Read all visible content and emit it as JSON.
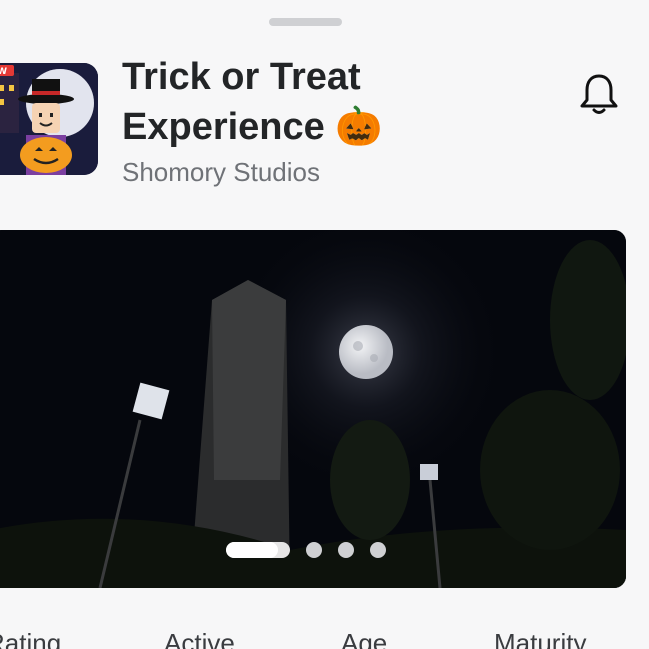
{
  "experience": {
    "title_line1": "Trick or Treat",
    "title_line2": "Experience",
    "title_emoji": "🎃",
    "studio": "Shomory Studios",
    "thumbnail_badge": "EW"
  },
  "carousel": {
    "slide_count": 4,
    "active_index": 0
  },
  "stats": {
    "labels": [
      "Rating",
      "Active",
      "Age",
      "Maturity"
    ]
  },
  "colors": {
    "background": "#f7f7f8",
    "title": "#232527",
    "subtitle": "#6f7277",
    "dot_inactive": "#cfd0d3"
  }
}
